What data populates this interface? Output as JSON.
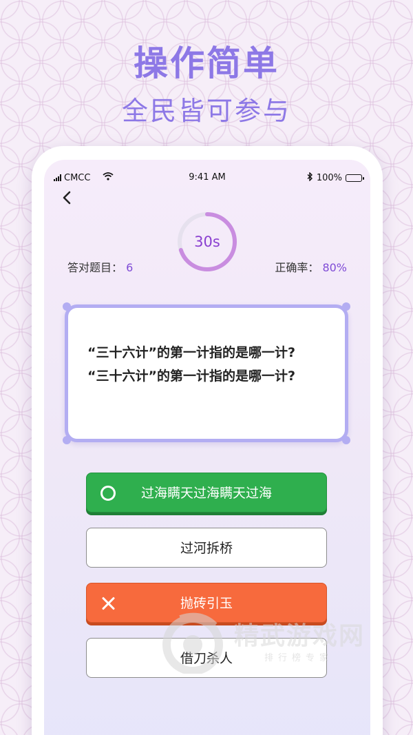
{
  "promo": {
    "headline": "操作简单",
    "subheadline": "全民皆可参与"
  },
  "status_bar": {
    "carrier": "CMCC",
    "time": "9:41 AM",
    "battery": "100%"
  },
  "quiz": {
    "timer": "30s",
    "timer_progress": 0.7,
    "correct_count_label": "答对题目：",
    "correct_count": "6",
    "accuracy_label": "正确率：",
    "accuracy": "80%",
    "question_lines": [
      "“三十六计”的第一计指的是哪一计?",
      "“三十六计”的第一计指的是哪一计?"
    ],
    "options": [
      {
        "label": "过海瞒天过海瞒天过海",
        "state": "correct"
      },
      {
        "label": "过河拆桥",
        "state": "neutral"
      },
      {
        "label": "抛砖引玉",
        "state": "wrong"
      },
      {
        "label": "借刀杀人",
        "state": "neutral"
      }
    ]
  },
  "watermark": {
    "title": "精武游戏网",
    "subtitle": "排行榜专家"
  },
  "icons": [
    "signal-icon",
    "wifi-icon",
    "bluetooth-icon",
    "battery-icon",
    "back-arrow-icon",
    "circle-icon",
    "x-icon"
  ],
  "colors": {
    "accent": "#8d78e6",
    "timer_ring": "#c98de0",
    "correct": "#2faf4e",
    "wrong": "#f76a3d",
    "card_border": "#b3adf2"
  }
}
